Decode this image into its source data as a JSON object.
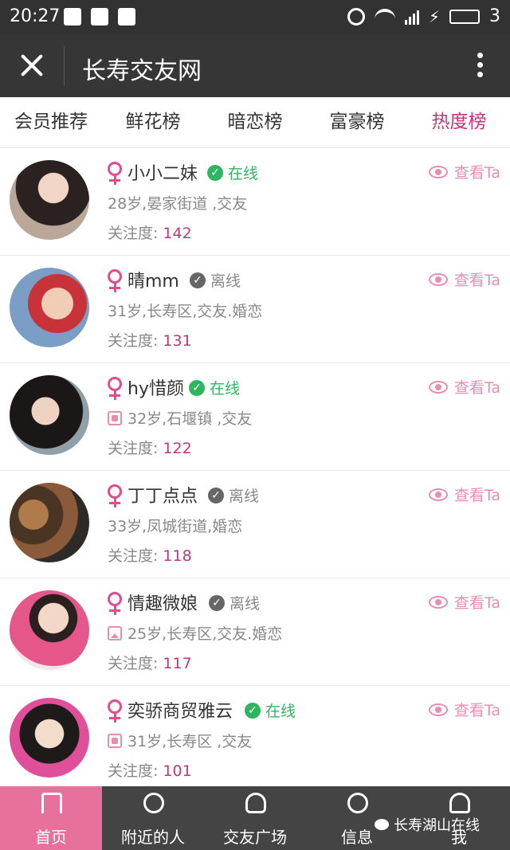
{
  "status_bar": {
    "time": "20:27",
    "battery": "3"
  },
  "header": {
    "title": "长寿交友网"
  },
  "tabs": [
    {
      "label": "会员推荐",
      "active": false
    },
    {
      "label": "鲜花榜",
      "active": false
    },
    {
      "label": "暗恋榜",
      "active": false
    },
    {
      "label": "富豪榜",
      "active": false
    },
    {
      "label": "热度榜",
      "active": true
    }
  ],
  "members": [
    {
      "name": "小小二妹",
      "status": "在线",
      "online": true,
      "info": "28岁,晏家街道 ,交友",
      "info_icon": "",
      "attention_label": "关注度:",
      "attention": "142",
      "view": "查看Ta"
    },
    {
      "name": "晴mm",
      "status": "离线",
      "online": false,
      "info": "31岁,长寿区,交友.婚恋",
      "info_icon": "",
      "attention_label": "关注度:",
      "attention": "131",
      "view": "查看Ta"
    },
    {
      "name": "hy惜颜",
      "status": "在线",
      "online": true,
      "info": "32岁,石堰镇 ,交友",
      "info_icon": "phone-icon",
      "attention_label": "关注度:",
      "attention": "122",
      "view": "查看Ta"
    },
    {
      "name": "丁丁点点",
      "status": "离线",
      "online": false,
      "info": "33岁,凤城街道,婚恋",
      "info_icon": "",
      "attention_label": "关注度:",
      "attention": "118",
      "view": "查看Ta"
    },
    {
      "name": "情趣微娘",
      "status": "离线",
      "online": false,
      "info": "25岁,长寿区,交友.婚恋",
      "info_icon": "image-icon",
      "attention_label": "关注度:",
      "attention": "117",
      "view": "查看Ta"
    },
    {
      "name": "奕骄商贸雅云",
      "status": "在线",
      "online": true,
      "info": "31岁,长寿区 ,交友",
      "info_icon": "phone-icon",
      "attention_label": "关注度:",
      "attention": "101",
      "view": "查看Ta"
    }
  ],
  "nav": [
    {
      "label": "首页",
      "icon": "home-icon",
      "active": true
    },
    {
      "label": "附近的人",
      "icon": "search-icon",
      "active": false
    },
    {
      "label": "交友广场",
      "icon": "people-icon",
      "active": false
    },
    {
      "label": "信息",
      "icon": "chat-icon",
      "active": false
    },
    {
      "label": "我",
      "icon": "user-icon",
      "active": false
    }
  ],
  "watermark": "长寿湖山在线",
  "colors": {
    "accent": "#c8337a",
    "online": "#2fb55f",
    "nav_active": "#e8709c",
    "header": "#363636"
  }
}
